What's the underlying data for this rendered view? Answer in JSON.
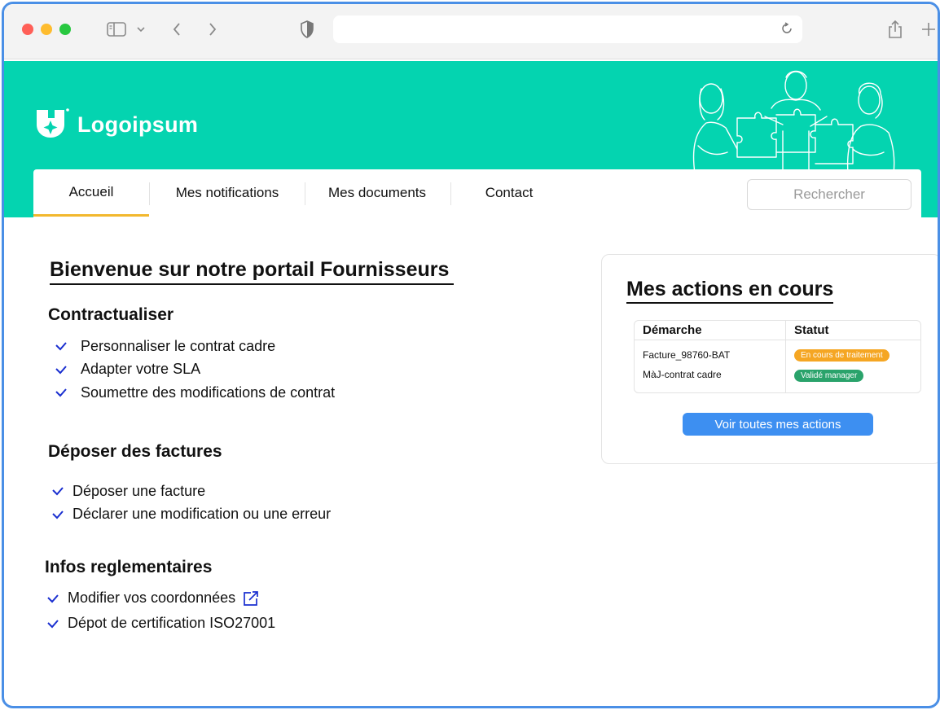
{
  "header": {
    "logo_text": "Logoipsum"
  },
  "nav": {
    "tabs": [
      {
        "label": "Accueil",
        "active": true
      },
      {
        "label": "Mes notifications",
        "active": false
      },
      {
        "label": "Mes documents",
        "active": false
      },
      {
        "label": "Contact",
        "active": false
      }
    ],
    "search_placeholder": "Rechercher"
  },
  "main": {
    "welcome_title": "Bienvenue sur notre portail Fournisseurs",
    "sections": [
      {
        "title": "Contractualiser",
        "items": [
          "Personnaliser le contrat cadre",
          "Adapter votre SLA",
          "Soumettre des modifications de contrat"
        ]
      },
      {
        "title": "Déposer des factures",
        "items": [
          "Déposer une facture",
          "Déclarer une modification ou une erreur"
        ]
      },
      {
        "title": "Infos reglementaires",
        "items": [
          "Modifier vos coordonnées",
          "Dépot de certification ISO27001"
        ]
      }
    ]
  },
  "actions": {
    "title": "Mes actions en cours",
    "columns": [
      "Démarche",
      "Statut"
    ],
    "rows": [
      {
        "demarche": "Facture_98760-BAT",
        "statut": "En cours de traitement",
        "color": "#f5a623"
      },
      {
        "demarche": "MàJ-contrat cadre",
        "statut": "Validé manager",
        "color": "#2aa36b"
      }
    ],
    "button_label": "Voir toutes mes actions"
  },
  "colors": {
    "brand": "#04d4b0",
    "accent": "#f2b82e",
    "primary_button": "#3d8ff1",
    "check": "#1a2fd0"
  },
  "icons": [
    "sidebar-icon",
    "chevron-down-icon",
    "chevron-left-icon",
    "chevron-right-icon",
    "shield-icon",
    "reload-icon",
    "share-icon",
    "plus-icon",
    "check-icon",
    "external-link-icon",
    "logo-icon"
  ]
}
